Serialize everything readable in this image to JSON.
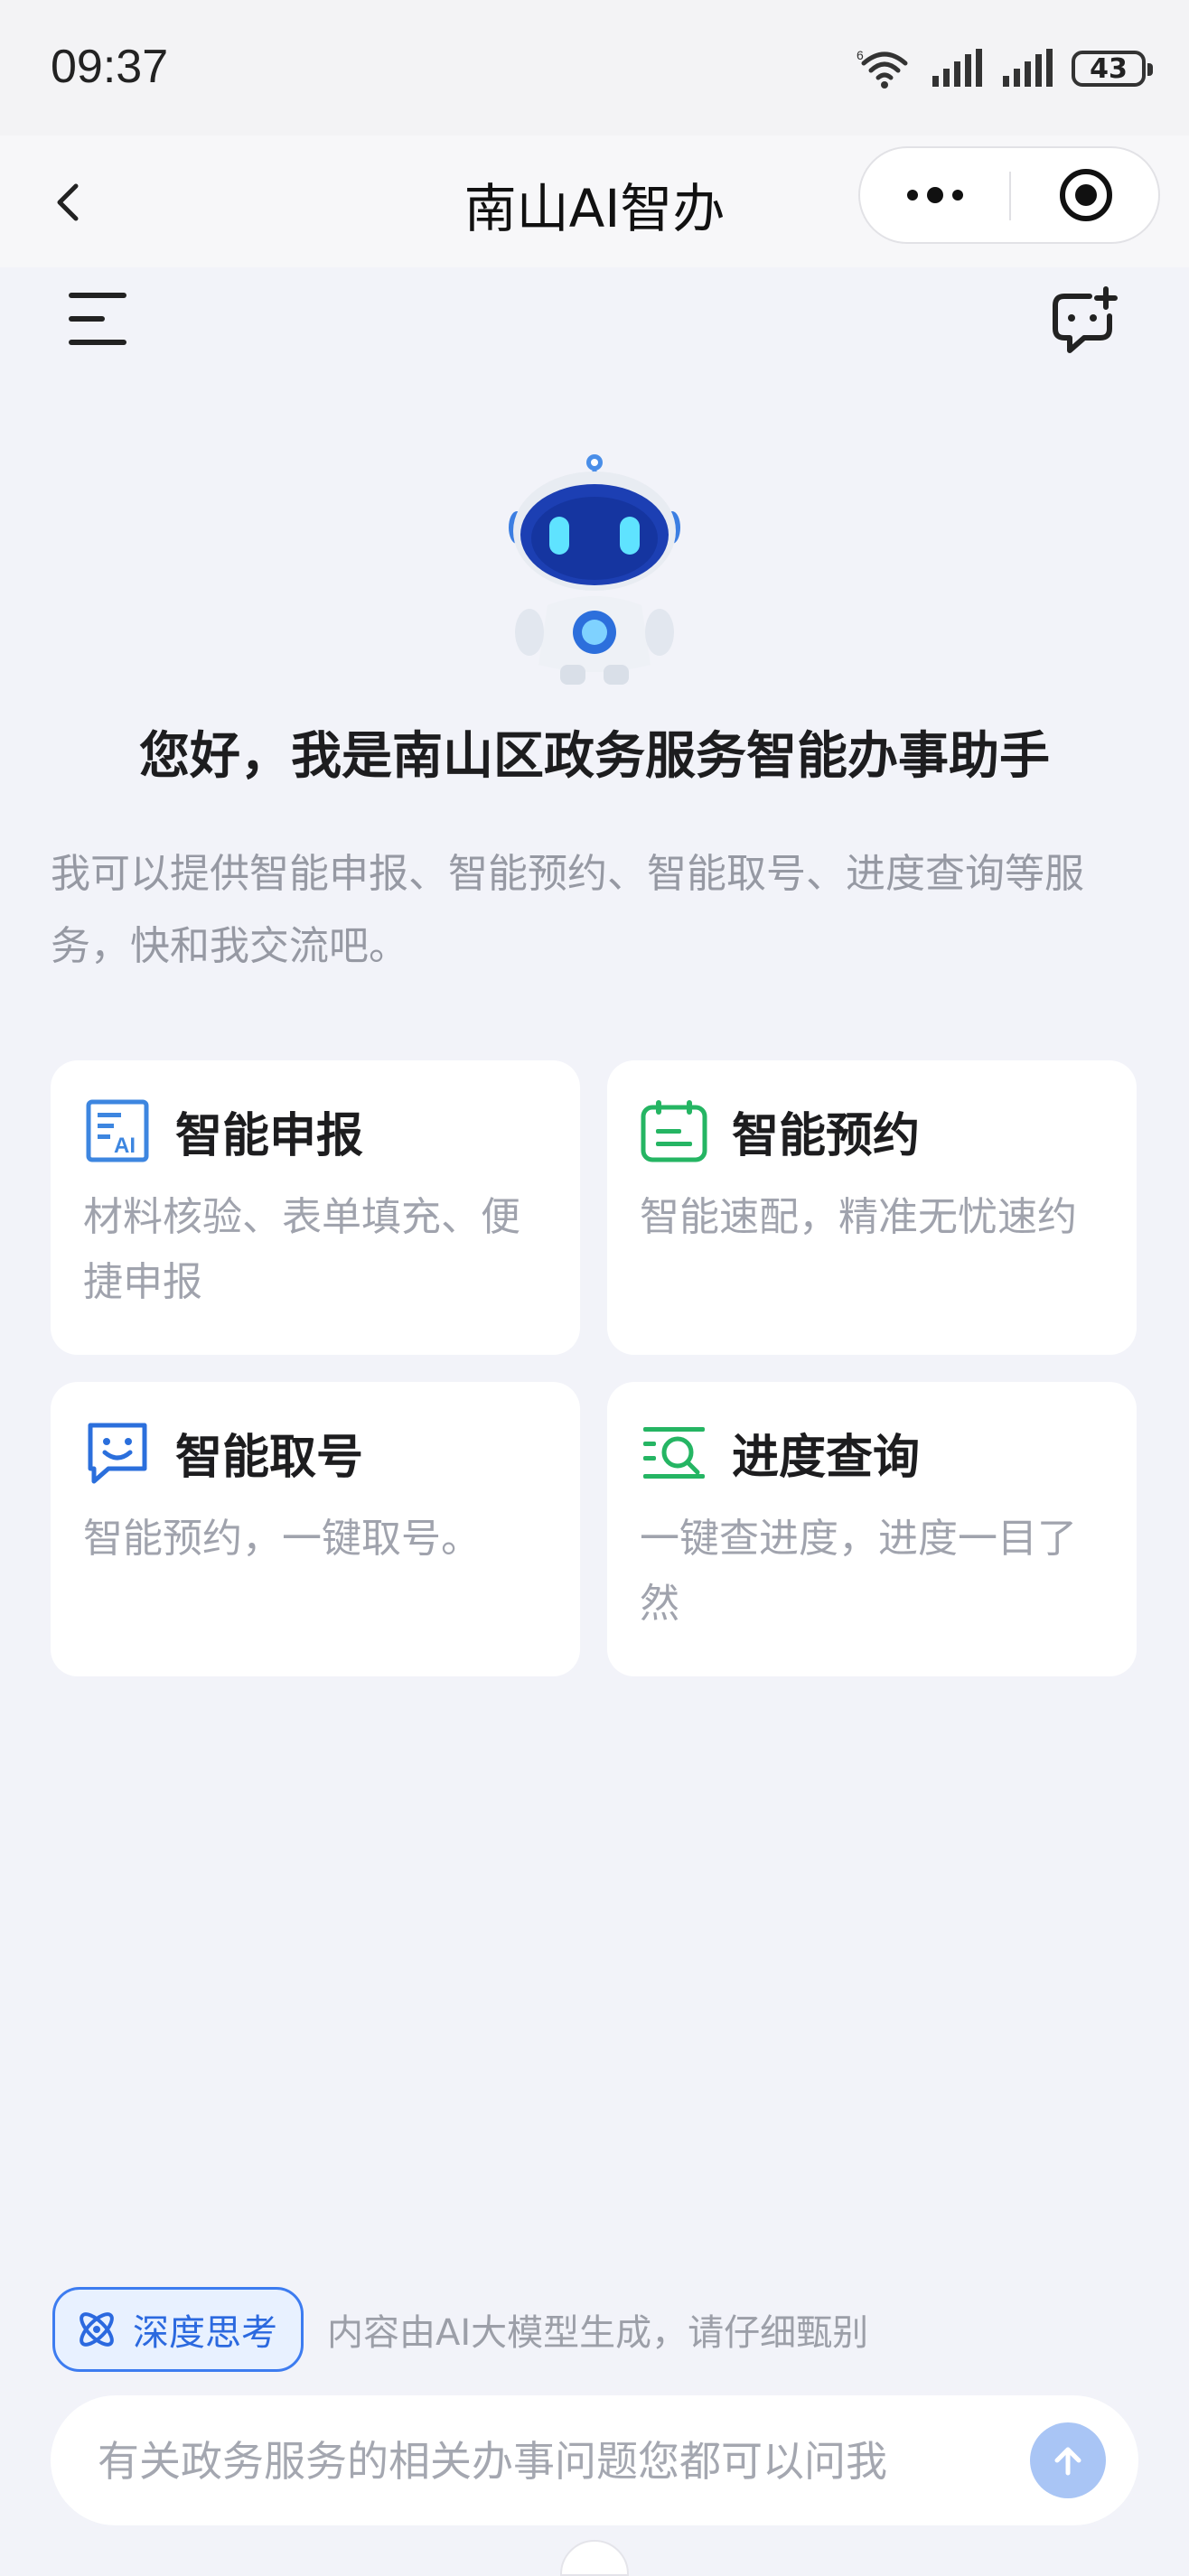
{
  "status_bar": {
    "time": "09:37",
    "battery": "43"
  },
  "navbar": {
    "title": "南山AI智办"
  },
  "greeting": "您好，我是南山区政务服务智能办事助手",
  "intro": "我可以提供智能申报、智能预约、智能取号、进度查询等服务，快和我交流吧。",
  "cards": [
    {
      "title": "智能申报",
      "desc": "材料核验、表单填充、便捷申报",
      "icon": "ai-document-icon",
      "color": "#3d86e0"
    },
    {
      "title": "智能预约",
      "desc": "智能速配，精准无忧速约",
      "icon": "calendar-icon",
      "color": "#25b563"
    },
    {
      "title": "智能取号",
      "desc": "智能预约，一键取号。",
      "icon": "chat-smile-icon",
      "color": "#2b6fdc"
    },
    {
      "title": "进度查询",
      "desc": "一键查进度，进度一目了然",
      "icon": "list-search-icon",
      "color": "#25b563"
    }
  ],
  "bottom": {
    "deep_think_label": "深度思考",
    "disclaimer": "内容由AI大模型生成，请仔细甄别",
    "input_placeholder": "有关政务服务的相关办事问题您都可以问我"
  },
  "colors": {
    "accent": "#3d7cf0",
    "background": "#f2f3f9",
    "send_button": "#a9c5f5"
  }
}
